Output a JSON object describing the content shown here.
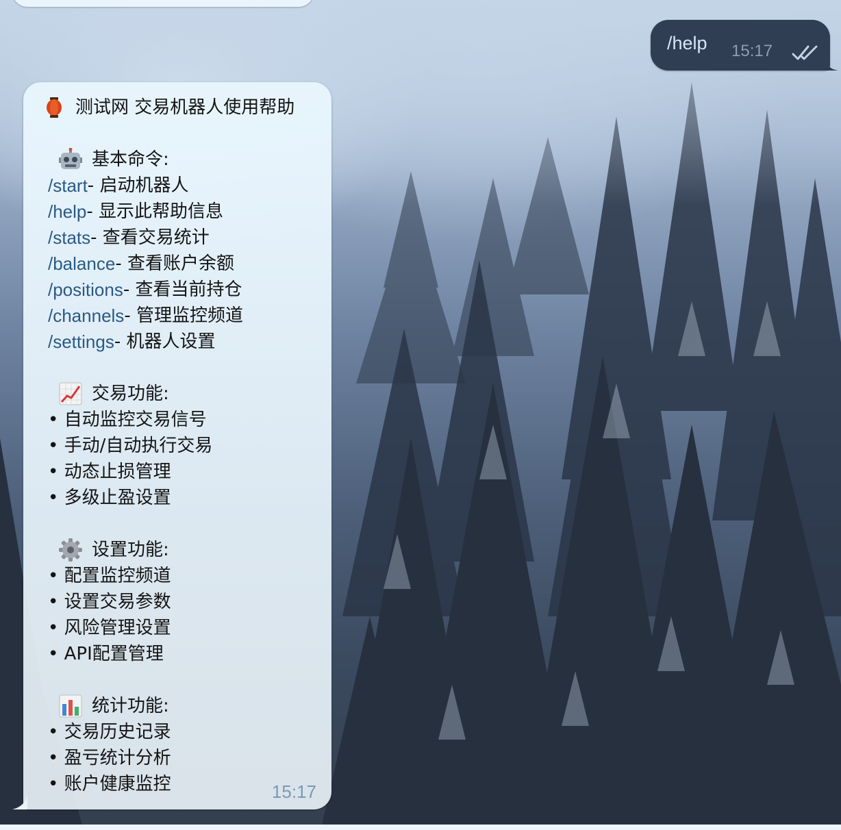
{
  "outgoing": {
    "text": "/help",
    "time": "15:17",
    "status_icon": "double-check-icon"
  },
  "incoming": {
    "time": "15:17",
    "title_icon": "lantern-icon",
    "title": "测试网 交易机器人使用帮助",
    "sections": {
      "basic": {
        "icon": "robot-icon",
        "heading": "基本命令:",
        "commands": [
          {
            "cmd": "/start",
            "desc": " - 启动机器人"
          },
          {
            "cmd": "/help",
            "desc": " - 显示此帮助信息"
          },
          {
            "cmd": "/stats",
            "desc": " - 查看交易统计"
          },
          {
            "cmd": "/balance",
            "desc": " - 查看账户余额"
          },
          {
            "cmd": "/positions",
            "desc": " - 查看当前持仓"
          },
          {
            "cmd": "/channels",
            "desc": " - 管理监控频道"
          },
          {
            "cmd": "/settings",
            "desc": " - 机器人设置"
          }
        ]
      },
      "trading": {
        "icon": "chart-increasing-icon",
        "heading": "交易功能:",
        "items": [
          "• 自动监控交易信号",
          "• 手动/自动执行交易",
          "• 动态止损管理",
          "• 多级止盈设置"
        ]
      },
      "settings": {
        "icon": "gear-icon",
        "heading": "设置功能:",
        "items": [
          "• 配置监控频道",
          "• 设置交易参数",
          "• 风险管理设置",
          "• API配置管理"
        ]
      },
      "stats": {
        "icon": "bar-chart-icon",
        "heading": "统计功能:",
        "items": [
          "• 交易历史记录",
          "• 盈亏统计分析",
          "• 账户健康监控"
        ]
      }
    }
  },
  "colors": {
    "command_link": "#2a5a85",
    "outgoing_bubble": "#2f3e52",
    "incoming_bubble": "#e8f5fd"
  }
}
